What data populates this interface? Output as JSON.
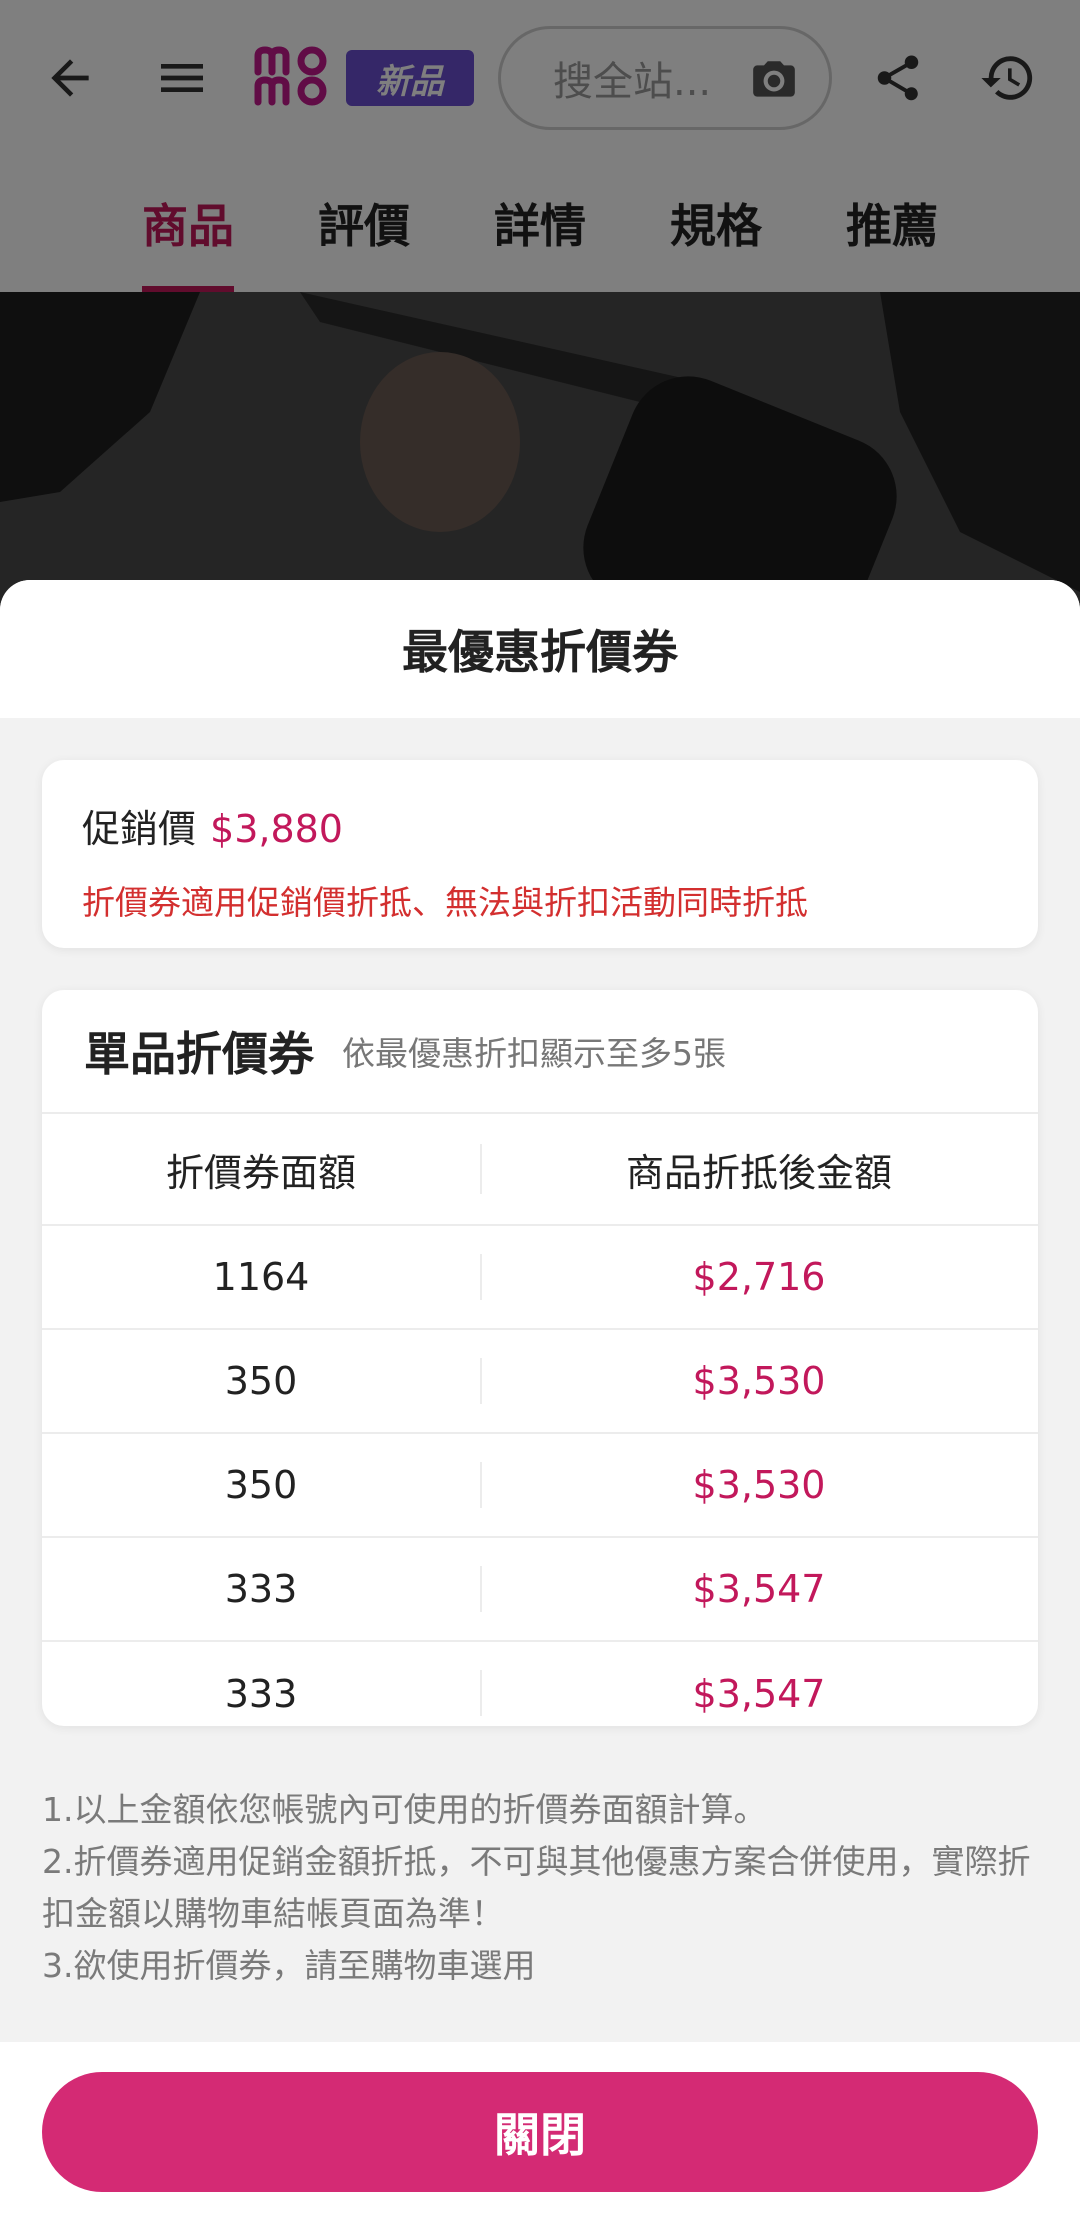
{
  "header": {
    "logo_text": "momo",
    "new_badge": "新品",
    "search_placeholder": "搜全站...",
    "icons": [
      "back-arrow-icon",
      "menu-icon",
      "camera-icon",
      "share-icon",
      "history-icon"
    ]
  },
  "tabs": [
    {
      "label": "商品",
      "active": true
    },
    {
      "label": "評價",
      "active": false
    },
    {
      "label": "詳情",
      "active": false
    },
    {
      "label": "規格",
      "active": false
    },
    {
      "label": "推薦",
      "active": false
    }
  ],
  "sheet": {
    "title": "最優惠折價券",
    "promo": {
      "label": "促銷價",
      "price": "$3,880",
      "note": "折價券適用促銷價折抵、無法與折扣活動同時折抵"
    },
    "coupons": {
      "title": "單品折價券",
      "subtitle": "依最優惠折扣顯示至多5張",
      "columns": [
        "折價券面額",
        "商品折抵後金額"
      ],
      "rows": [
        {
          "amount": "1164",
          "after": "$2,716"
        },
        {
          "amount": "350",
          "after": "$3,530"
        },
        {
          "amount": "350",
          "after": "$3,530"
        },
        {
          "amount": "333",
          "after": "$3,547"
        },
        {
          "amount": "333",
          "after": "$3,547"
        }
      ]
    },
    "notes": [
      "1.以上金額依您帳號內可使用的折價券面額計算。",
      "2.折價券適用促銷金額折抵，不可與其他優惠方案合併使用，實際折扣金額以購物車結帳頁面為準！",
      "3.欲使用折價券，請至購物車選用"
    ],
    "close_label": "關閉"
  },
  "colors": {
    "accent": "#c2185b",
    "button": "#d42a74",
    "warning_text": "#d32f2f",
    "badge": "#6a4fd0"
  }
}
